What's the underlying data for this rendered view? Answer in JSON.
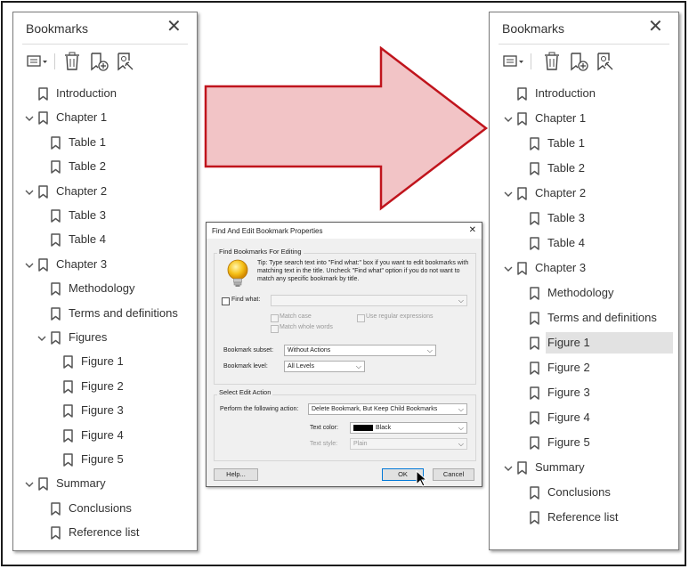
{
  "left_panel": {
    "title": "Bookmarks",
    "items": [
      {
        "label": "Introduction",
        "level": 0,
        "expander": false
      },
      {
        "label": "Chapter 1",
        "level": 0,
        "expander": true
      },
      {
        "label": "Table 1",
        "level": 1,
        "expander": false
      },
      {
        "label": "Table 2",
        "level": 1,
        "expander": false
      },
      {
        "label": "Chapter 2",
        "level": 0,
        "expander": true
      },
      {
        "label": "Table 3",
        "level": 1,
        "expander": false
      },
      {
        "label": "Table 4",
        "level": 1,
        "expander": false
      },
      {
        "label": "Chapter 3",
        "level": 0,
        "expander": true
      },
      {
        "label": "Methodology",
        "level": 1,
        "expander": false
      },
      {
        "label": "Terms and definitions",
        "level": 1,
        "expander": false
      },
      {
        "label": "Figures",
        "level": 1,
        "expander": true
      },
      {
        "label": "Figure 1",
        "level": 2,
        "expander": false
      },
      {
        "label": "Figure 2",
        "level": 2,
        "expander": false
      },
      {
        "label": "Figure 3",
        "level": 2,
        "expander": false
      },
      {
        "label": "Figure 4",
        "level": 2,
        "expander": false
      },
      {
        "label": "Figure 5",
        "level": 2,
        "expander": false
      },
      {
        "label": "Summary",
        "level": 0,
        "expander": true
      },
      {
        "label": "Conclusions",
        "level": 1,
        "expander": false
      },
      {
        "label": "Reference list",
        "level": 1,
        "expander": false
      }
    ]
  },
  "right_panel": {
    "title": "Bookmarks",
    "items": [
      {
        "label": "Introduction",
        "level": 0,
        "expander": false
      },
      {
        "label": "Chapter 1",
        "level": 0,
        "expander": true
      },
      {
        "label": "Table 1",
        "level": 1,
        "expander": false
      },
      {
        "label": "Table 2",
        "level": 1,
        "expander": false
      },
      {
        "label": "Chapter 2",
        "level": 0,
        "expander": true
      },
      {
        "label": "Table 3",
        "level": 1,
        "expander": false
      },
      {
        "label": "Table 4",
        "level": 1,
        "expander": false
      },
      {
        "label": "Chapter 3",
        "level": 0,
        "expander": true
      },
      {
        "label": "Methodology",
        "level": 1,
        "expander": false
      },
      {
        "label": "Terms and definitions",
        "level": 1,
        "expander": false
      },
      {
        "label": "Figure 1",
        "level": 1,
        "expander": false,
        "selected": true
      },
      {
        "label": "Figure 2",
        "level": 1,
        "expander": false
      },
      {
        "label": "Figure 3",
        "level": 1,
        "expander": false
      },
      {
        "label": "Figure 4",
        "level": 1,
        "expander": false
      },
      {
        "label": "Figure 5",
        "level": 1,
        "expander": false
      },
      {
        "label": "Summary",
        "level": 0,
        "expander": true
      },
      {
        "label": "Conclusions",
        "level": 1,
        "expander": false
      },
      {
        "label": "Reference list",
        "level": 1,
        "expander": false
      }
    ]
  },
  "toolbar_icons": [
    "options-menu-icon",
    "delete-bookmark-icon",
    "new-bookmark-icon",
    "bookmark-settings-icon"
  ],
  "colors": {
    "arrow_fill": "#f2c4c6",
    "arrow_stroke": "#c0141c",
    "selection": "#e2e2e2",
    "dialog_bg": "#f0f0f0",
    "default_button_border": "#0078d7"
  },
  "dialog": {
    "title": "Find And Edit Bookmark Properties",
    "find_group": "Find Bookmarks For Editing",
    "tip": "Tip: Type search text into \"Find what:\" box if you want to edit bookmarks with matching text in the title. Uncheck \"Find what\" option if you do not want to match any specific bookmark by title.",
    "find_what_label": "Find what:",
    "match_case": "Match case",
    "use_regex": "Use regular expressions",
    "match_whole_words": "Match whole words",
    "subset_label": "Bookmark subset:",
    "subset_value": "Without Actions",
    "level_label": "Bookmark level:",
    "level_value": "All Levels",
    "edit_group": "Select Edit Action",
    "action_label": "Perform the following action:",
    "action_value": "Delete Bookmark, But Keep Child Bookmarks",
    "text_color_label": "Text color:",
    "text_color_value": "Black",
    "text_style_label": "Text style:",
    "text_style_value": "Plain",
    "help_button": "Help...",
    "ok_button": "OK",
    "cancel_button": "Cancel"
  }
}
